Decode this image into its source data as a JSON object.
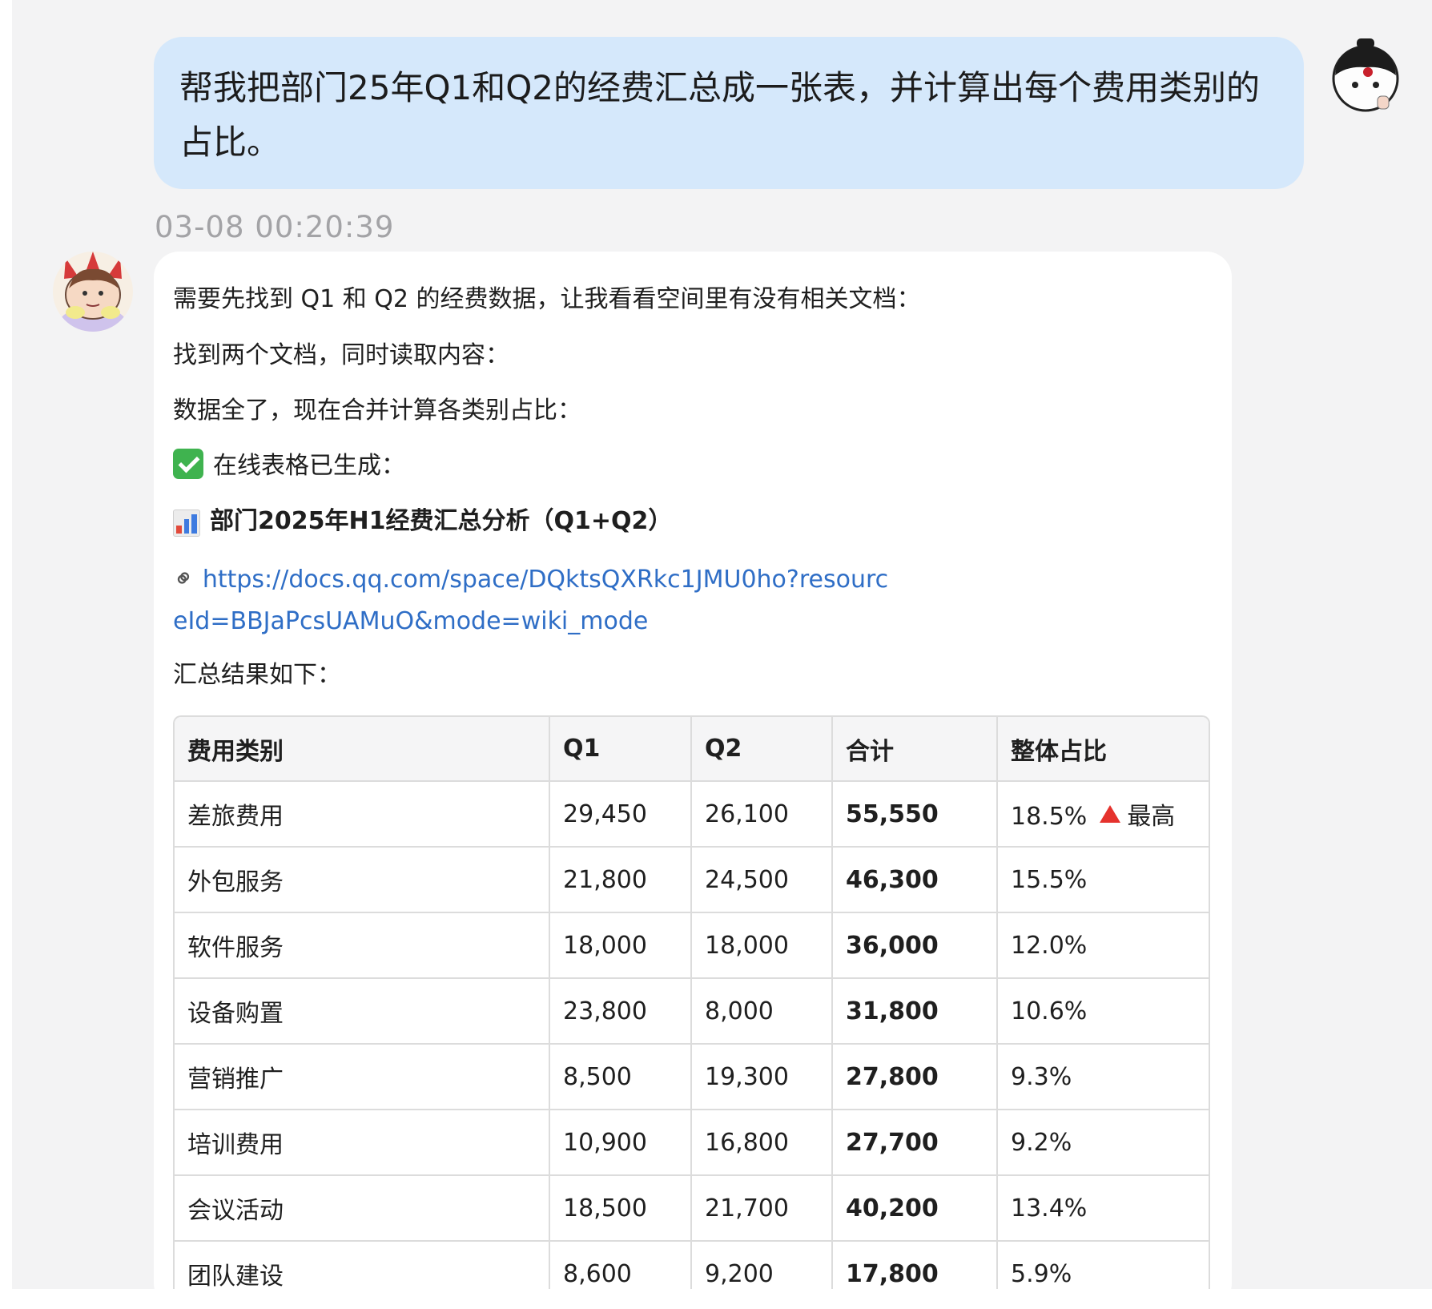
{
  "user_message": {
    "text": "帮我把部门25年Q1和Q2的经费汇总成一张表，并计算出每个费用类别的占比。"
  },
  "timestamp": "03-08 00:20:39",
  "bot_message": {
    "lines": [
      "需要先找到 Q1 和 Q2 的经费数据，让我看看空间里有没有相关文档：",
      "找到两个文档，同时读取内容：",
      "数据全了，现在合并计算各类别占比："
    ],
    "status_text": "在线表格已生成：",
    "doc_title": "部门2025年H1经费汇总分析（Q1+Q2）",
    "link_url": "https://docs.qq.com/space/DQktsQXRkc1JMU0ho?resourceId=BBJaPcsUAMuO&mode=wiki_mode",
    "summary_label": "汇总结果如下："
  },
  "table": {
    "headers": [
      "费用类别",
      "Q1",
      "Q2",
      "合计",
      "整体占比"
    ],
    "rows": [
      {
        "category": "差旅费用",
        "q1": "29,450",
        "q2": "26,100",
        "total": "55,550",
        "share": "18.5%",
        "badge": "最高"
      },
      {
        "category": "外包服务",
        "q1": "21,800",
        "q2": "24,500",
        "total": "46,300",
        "share": "15.5%"
      },
      {
        "category": "软件服务",
        "q1": "18,000",
        "q2": "18,000",
        "total": "36,000",
        "share": "12.0%"
      },
      {
        "category": "设备购置",
        "q1": "23,800",
        "q2": "8,000",
        "total": "31,800",
        "share": "10.6%"
      },
      {
        "category": "营销推广",
        "q1": "8,500",
        "q2": "19,300",
        "total": "27,800",
        "share": "9.3%"
      },
      {
        "category": "培训费用",
        "q1": "10,900",
        "q2": "16,800",
        "total": "27,700",
        "share": "9.2%"
      },
      {
        "category": "会议活动",
        "q1": "18,500",
        "q2": "21,700",
        "total": "40,200",
        "share": "13.4%"
      },
      {
        "category": "团队建设",
        "q1": "8,600",
        "q2": "9,200",
        "total": "17,800",
        "share": "5.9%"
      }
    ]
  },
  "icons": {
    "status": "check-mark-icon",
    "doc": "bar-chart-icon",
    "link": "link-icon",
    "badge": "red-triangle-icon"
  },
  "colors": {
    "user_bubble": "#d5e8fb",
    "link": "#2f6ec6",
    "check": "#3fb34f",
    "triangle": "#e5322d"
  }
}
